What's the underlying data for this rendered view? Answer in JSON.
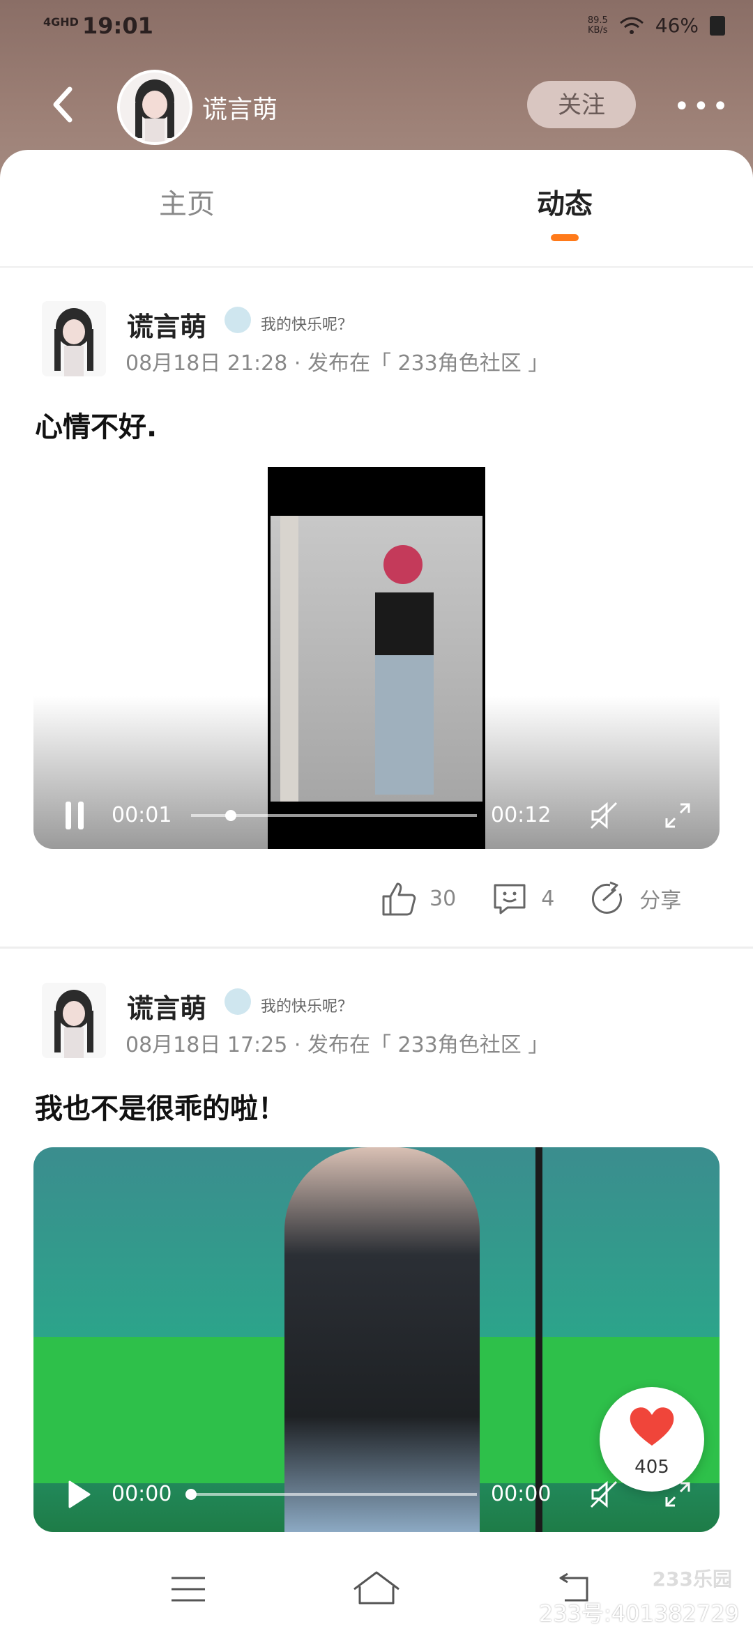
{
  "status_bar": {
    "network": "4GHD",
    "time": "19:01",
    "speed_value": "89.5",
    "speed_unit": "KB/s",
    "battery": "46%"
  },
  "header": {
    "username": "谎言萌",
    "follow_label": "关注",
    "more_label": "•••"
  },
  "tabs": {
    "home": "主页",
    "feed": "动态"
  },
  "posts": [
    {
      "author": "谎言萌",
      "status_note": "我的快乐呢？",
      "meta": "08月18日 21:28 · 发布在「 233角色社区 」",
      "content": "心情不好.",
      "video": {
        "current_time": "00:01",
        "duration": "00:12",
        "progress": 0.14
      },
      "likes": "30",
      "comments": "4",
      "share_label": "分享"
    },
    {
      "author": "谎言萌",
      "status_note": "我的快乐呢？",
      "meta": "08月18日 17:25 · 发布在「 233角色社区 」",
      "content": "我也不是很乖的啦！",
      "video": {
        "current_time": "00:00",
        "duration": "00:00",
        "progress": 0
      }
    }
  ],
  "floating_like": {
    "count": "405"
  },
  "watermark": {
    "logo": "233乐园",
    "id_text": "233号:401382729"
  },
  "colors": {
    "accent": "#ff7a1a",
    "header_bg": "#9c7f75",
    "like_red": "#f0453a"
  }
}
